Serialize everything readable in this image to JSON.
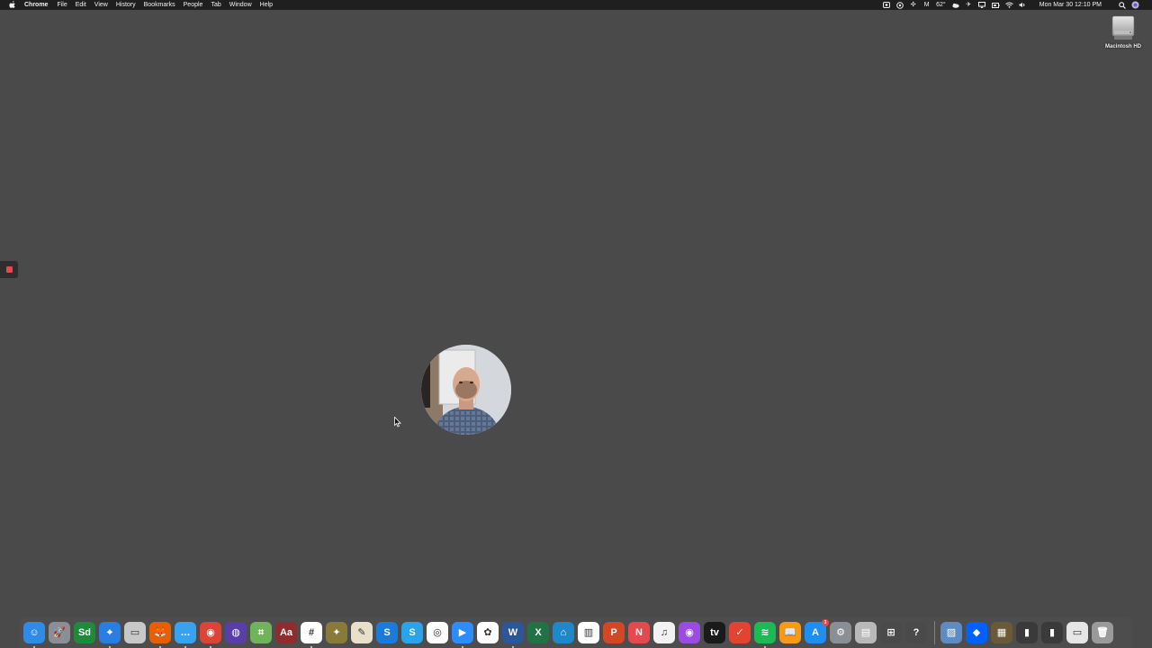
{
  "menubar": {
    "app_name": "Chrome",
    "menus": [
      "File",
      "Edit",
      "View",
      "History",
      "Bookmarks",
      "People",
      "Tab",
      "Window",
      "Help"
    ],
    "status": {
      "temperature": "62°",
      "clock": "Mon Mar 30  12:10 PM"
    }
  },
  "desktop": {
    "background_color": "#4a4a4a",
    "icons": [
      {
        "label": "Macintosh HD",
        "icon": "hard-drive-icon"
      }
    ]
  },
  "recording": {
    "icon": "record-stop-icon",
    "color": "#e5484d"
  },
  "webcam": {
    "icon": "webcam-bubble"
  },
  "dock": {
    "apps": [
      {
        "name": "finder-icon",
        "glyph": "☺",
        "bg": "#2f8be6",
        "running": true
      },
      {
        "name": "launchpad-icon",
        "glyph": "🚀",
        "bg": "#8a8f96",
        "running": false
      },
      {
        "name": "sheets-icon",
        "glyph": "Sd",
        "bg": "#1e8a3c",
        "running": false
      },
      {
        "name": "safari-icon",
        "glyph": "⌖",
        "bg": "#2a7de1",
        "running": true
      },
      {
        "name": "drive-icon",
        "glyph": "▭",
        "bg": "#c8c8c8",
        "running": false
      },
      {
        "name": "firefox-icon",
        "glyph": "🦊",
        "bg": "#e66000",
        "running": true
      },
      {
        "name": "messages-icon",
        "glyph": "…",
        "bg": "#3aa0f0",
        "running": true
      },
      {
        "name": "chrome-icon",
        "glyph": "◉",
        "bg": "#db4437",
        "running": true
      },
      {
        "name": "siri-icon",
        "glyph": "◍",
        "bg": "#5a3ea8",
        "running": false
      },
      {
        "name": "maps-icon",
        "glyph": "⌗",
        "bg": "#6fb35a",
        "running": false
      },
      {
        "name": "dictionary-icon",
        "glyph": "Aa",
        "bg": "#8e2d2d",
        "running": false
      },
      {
        "name": "slack-icon",
        "glyph": "#",
        "bg": "#ffffff",
        "running": true
      },
      {
        "name": "cyberduck-icon",
        "glyph": "✦",
        "bg": "#8a7a3a",
        "running": false
      },
      {
        "name": "textedit-icon",
        "glyph": "✎",
        "bg": "#e8e0c8",
        "running": false
      },
      {
        "name": "scrivener-icon",
        "glyph": "S",
        "bg": "#1c7ad9",
        "running": false
      },
      {
        "name": "skype-icon",
        "glyph": "S",
        "bg": "#2aa3e8",
        "running": false
      },
      {
        "name": "helm-icon",
        "glyph": "◎",
        "bg": "#ffffff",
        "running": false
      },
      {
        "name": "zoom-icon",
        "glyph": "▶",
        "bg": "#2d8cff",
        "running": true
      },
      {
        "name": "photos-icon",
        "glyph": "✿",
        "bg": "#ffffff",
        "running": false
      },
      {
        "name": "word-icon",
        "glyph": "W",
        "bg": "#2b579a",
        "running": true
      },
      {
        "name": "excel-icon",
        "glyph": "X",
        "bg": "#217346",
        "running": false
      },
      {
        "name": "keynote-icon",
        "glyph": "⌂",
        "bg": "#1e88c8",
        "running": false
      },
      {
        "name": "numbers-icon",
        "glyph": "▥",
        "bg": "#ffffff",
        "running": false
      },
      {
        "name": "powerpoint-icon",
        "glyph": "P",
        "bg": "#d24726",
        "running": false
      },
      {
        "name": "news-icon",
        "glyph": "N",
        "bg": "#e5484d",
        "running": false
      },
      {
        "name": "music-icon",
        "glyph": "♫",
        "bg": "#f2f2f2",
        "running": false
      },
      {
        "name": "podcasts-icon",
        "glyph": "◉",
        "bg": "#9b4ce0",
        "running": false
      },
      {
        "name": "apple-tv-icon",
        "glyph": "tv",
        "bg": "#1a1a1a",
        "running": false
      },
      {
        "name": "todoist-icon",
        "glyph": "✓",
        "bg": "#e44332",
        "running": false
      },
      {
        "name": "spotify-icon",
        "glyph": "≋",
        "bg": "#1db954",
        "running": true
      },
      {
        "name": "books-icon",
        "glyph": "📖",
        "bg": "#f79a16",
        "running": false
      },
      {
        "name": "app-store-icon",
        "glyph": "A",
        "bg": "#1e8ef0",
        "running": false,
        "badge": "3"
      },
      {
        "name": "system-preferences-icon",
        "glyph": "⚙",
        "bg": "#8a8f96",
        "running": false
      },
      {
        "name": "notes-icon",
        "glyph": "▤",
        "bg": "#b9b9b9",
        "running": false
      },
      {
        "name": "grid-app-icon",
        "glyph": "⊞",
        "bg": "#4a4a4a",
        "running": false
      },
      {
        "name": "help-icon",
        "glyph": "?",
        "bg": "#4a4a4a",
        "running": false
      }
    ],
    "right": [
      {
        "name": "preview-icon",
        "glyph": "▨",
        "bg": "#5d8bc2"
      },
      {
        "name": "dropbox-icon",
        "glyph": "◆",
        "bg": "#0061fe"
      },
      {
        "name": "folder-downloads-icon",
        "glyph": "▦",
        "bg": "#6a5a3a"
      },
      {
        "name": "folder-docs-icon",
        "glyph": "▮",
        "bg": "#3a3a3a"
      },
      {
        "name": "folder-apps-icon",
        "glyph": "▮",
        "bg": "#3a3a3a"
      },
      {
        "name": "folder-stack-icon",
        "glyph": "▭",
        "bg": "#e6e6e6"
      },
      {
        "name": "trash-icon",
        "glyph": "🗑",
        "bg": "#9a9a9a"
      }
    ]
  }
}
